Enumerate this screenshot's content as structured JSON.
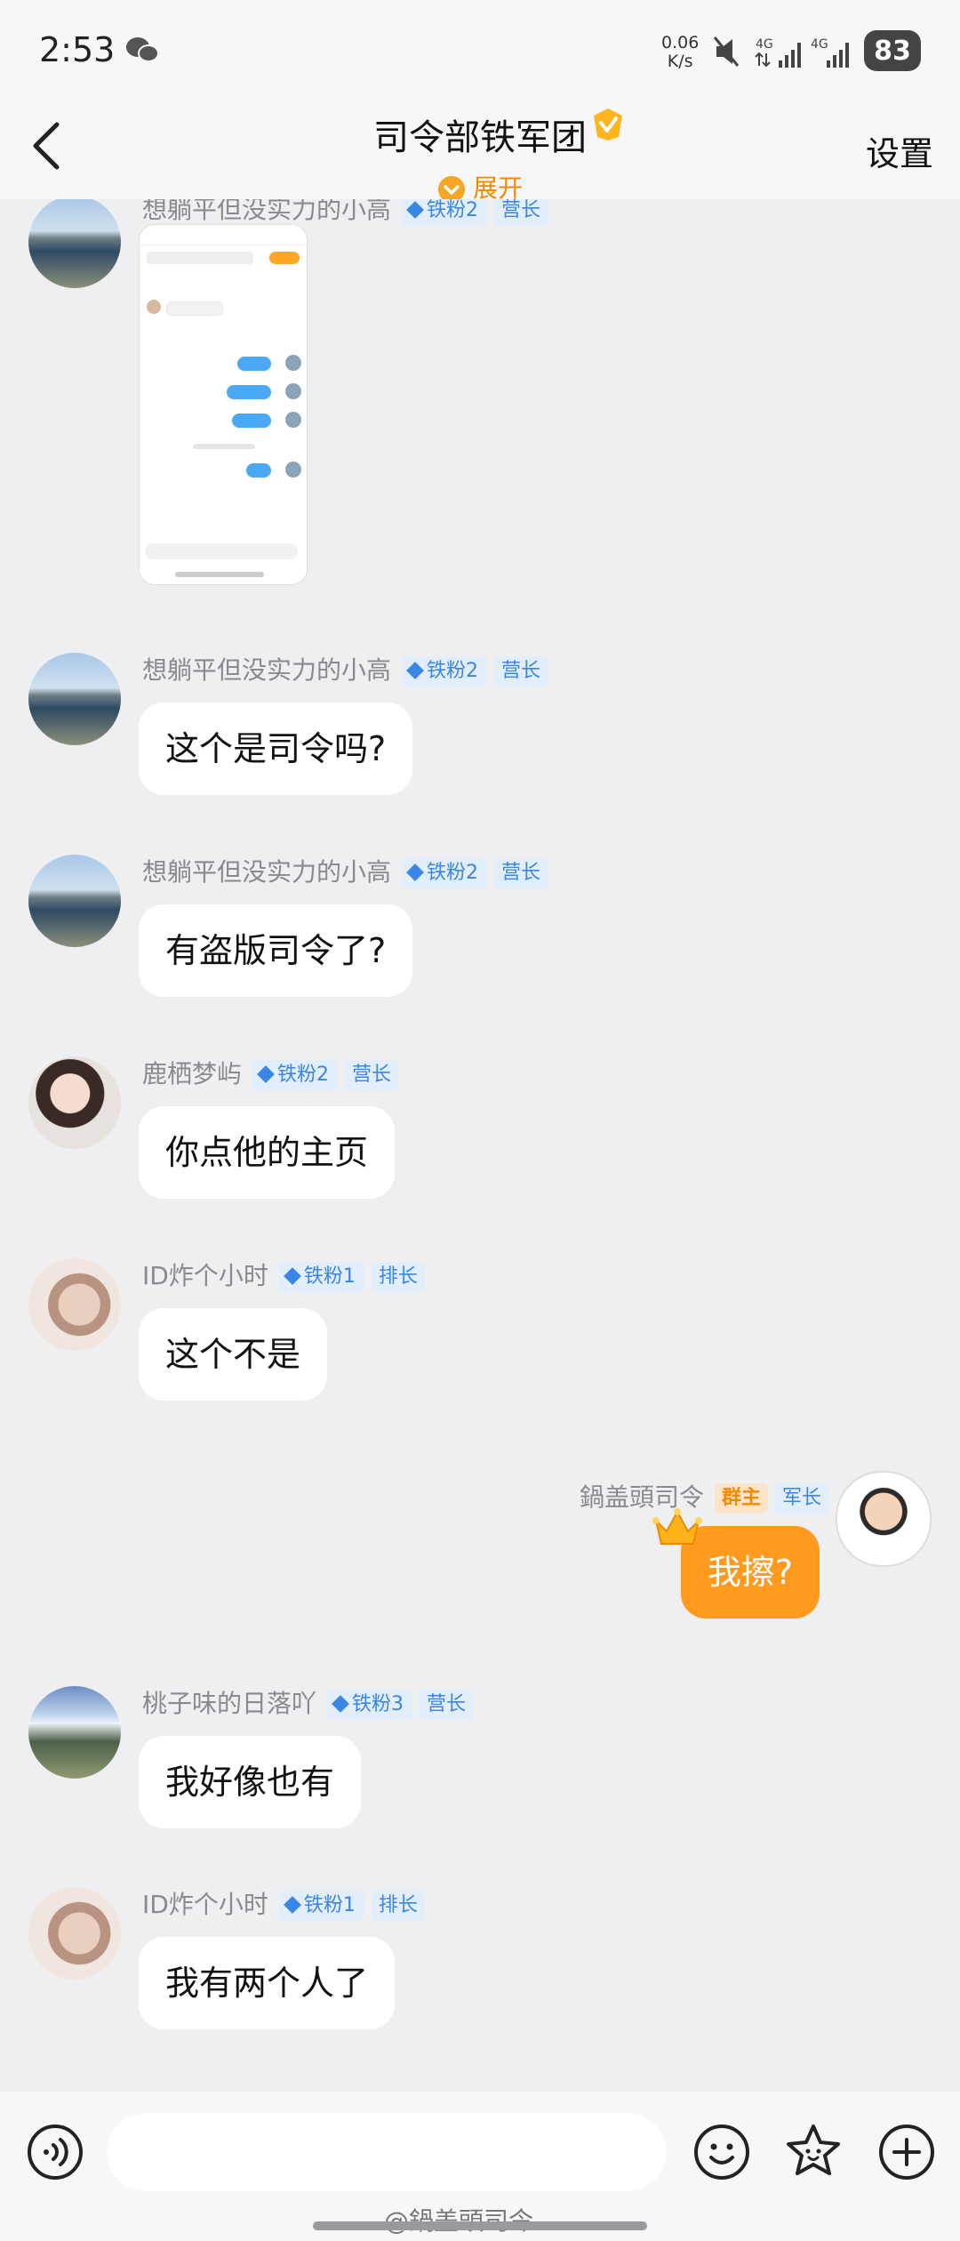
{
  "status_bar": {
    "time": "2:53",
    "net_speed_value": "0.06",
    "net_speed_unit": "K/s",
    "battery": "83"
  },
  "header": {
    "title": "司令部铁军团",
    "expand_label": "展开",
    "settings_label": "设置"
  },
  "colors": {
    "accent": "#ff9a1f",
    "expand": "#f08a00",
    "badge_blue": "#3a86e6",
    "bubble_bg": "#ffffff",
    "chat_bg": "#efeff1"
  },
  "messages": [
    {
      "name": "想躺平但没实力的小高",
      "fan_badge": "铁粉2",
      "rank": "营长",
      "type": "image",
      "avatar": "lake-avatar"
    },
    {
      "name": "想躺平但没实力的小高",
      "fan_badge": "铁粉2",
      "rank": "营长",
      "type": "text",
      "text": "这个是司令吗?",
      "avatar": "lake-avatar"
    },
    {
      "name": "想躺平但没实力的小高",
      "fan_badge": "铁粉2",
      "rank": "营长",
      "type": "text",
      "text": "有盗版司令了?",
      "avatar": "lake-avatar"
    },
    {
      "name": "鹿栖梦屿",
      "fan_badge": "铁粉2",
      "rank": "营长",
      "type": "text",
      "text": "你点他的主页",
      "avatar": "girl-avatar"
    },
    {
      "name": "ID炸个小时",
      "fan_badge": "铁粉1",
      "rank": "排长",
      "type": "text",
      "text": "这个不是",
      "avatar": "face-avatar"
    },
    {
      "name": "桃子味的日落吖",
      "fan_badge": "铁粉3",
      "rank": "营长",
      "type": "text",
      "text": "我好像也有",
      "avatar": "mountain-avatar"
    },
    {
      "name": "ID炸个小时",
      "fan_badge": "铁粉1",
      "rank": "排长",
      "type": "text",
      "text": "我有两个人了",
      "avatar": "face-avatar"
    }
  ],
  "my_message": {
    "name": "鍋盖頭司令",
    "owner_badge": "群主",
    "rank": "军长",
    "text": "我擦?"
  },
  "input": {
    "placeholder": "",
    "value": ""
  },
  "watermark_credit": "@鍋盖頭司令"
}
